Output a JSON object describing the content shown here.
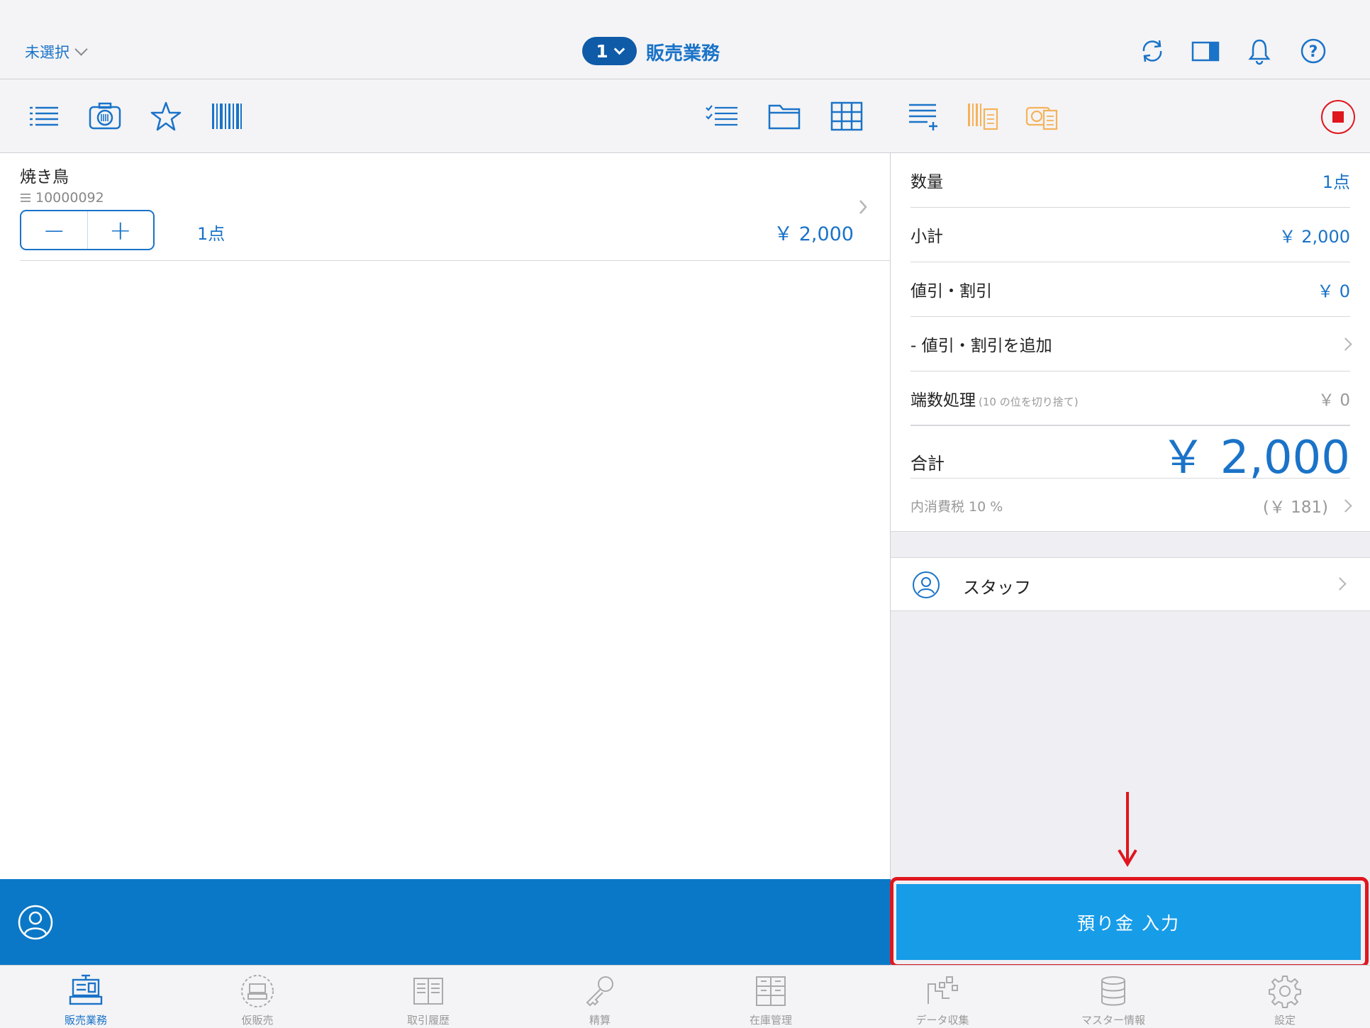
{
  "header": {
    "store_select": "未選択",
    "register_number": "1",
    "title": "販売業務"
  },
  "left_toolbar": {
    "icons": [
      "list-icon",
      "camera-barcode-icon",
      "star-icon",
      "barcode-icon",
      "checklist-icon",
      "folder-icon",
      "grid-icon"
    ]
  },
  "cart": {
    "items": [
      {
        "name": "焼き鳥",
        "code": "10000092",
        "qty": "1点",
        "price": "￥ 2,000"
      }
    ]
  },
  "summary": {
    "qty_label": "数量",
    "qty_value": "1点",
    "subtotal_label": "小計",
    "subtotal_value": "￥ 2,000",
    "discount_label": "値引・割引",
    "discount_value": "￥ 0",
    "add_discount_label": "- 値引・割引を追加",
    "rounding_label": "端数処理",
    "rounding_note": "(10 の位を切り捨て)",
    "rounding_value": "￥ 0",
    "total_label": "合計",
    "total_value": "￥ 2,000",
    "tax_label": "内消費税 10 %",
    "tax_value": "(￥ 181)"
  },
  "staff": {
    "label": "スタッフ"
  },
  "deposit_button": "預り金 入力",
  "tabs": [
    {
      "label": "販売業務",
      "icon": "register-icon",
      "active": true
    },
    {
      "label": "仮販売",
      "icon": "temp-register-icon",
      "active": false
    },
    {
      "label": "取引履歴",
      "icon": "history-book-icon",
      "active": false
    },
    {
      "label": "精算",
      "icon": "key-icon",
      "active": false
    },
    {
      "label": "在庫管理",
      "icon": "inventory-icon",
      "active": false
    },
    {
      "label": "データ収集",
      "icon": "data-collect-icon",
      "active": false
    },
    {
      "label": "マスター情報",
      "icon": "database-icon",
      "active": false
    },
    {
      "label": "設定",
      "icon": "gear-icon",
      "active": false
    }
  ],
  "colors": {
    "accent": "#1a73c8",
    "pill": "#0f5ba8",
    "blue_strip": "#0b78c7",
    "deposit_button": "#179ce8",
    "highlight_red": "#e0161e",
    "orange_icon": "#f5b25a"
  }
}
